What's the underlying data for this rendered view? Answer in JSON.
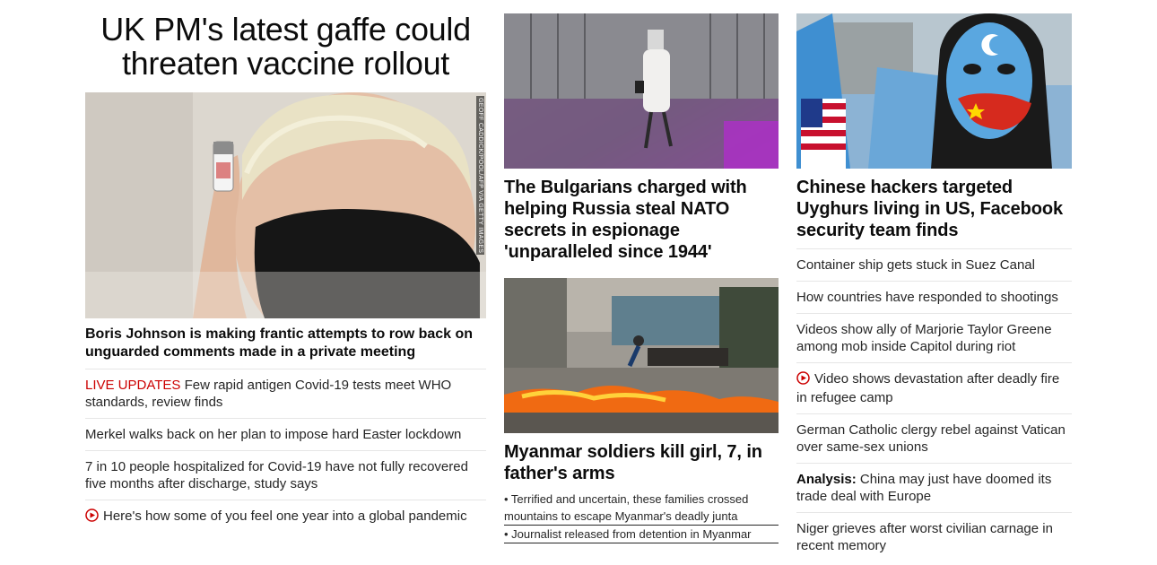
{
  "lead": {
    "title": "UK PM's latest gaffe could threaten vaccine rollout",
    "image_alt": "Boris Johnson holding vaccine vial, wearing black mask",
    "image_credit": "GEOFF CADDICK/POOL/AFP VIA GETTY IMAGES",
    "subheadline": "Boris Johnson is making frantic attempts to row back on unguarded comments made in a private meeting",
    "stories": [
      {
        "prefix": "LIVE UPDATES",
        "text": " Few rapid antigen Covid-19 tests meet WHO standards, review finds"
      },
      {
        "text": "Merkel walks back on her plan to impose hard Easter lockdown"
      },
      {
        "text": "7 in 10 people hospitalized for Covid-19 have not fully recovered five months after discharge, study says"
      },
      {
        "text": "Here's how some of you feel one year into a global pandemic",
        "icon": "play-icon"
      }
    ]
  },
  "middle": {
    "story1": {
      "title": "The Bulgarians charged with helping Russia steal NATO secrets in espionage 'unparalleled since 1944'"
    },
    "story2": {
      "title": "Myanmar soldiers kill girl, 7, in father's arms",
      "links": [
        "• Terrified and uncertain, these families crossed mountains to escape Myanmar's deadly junta",
        "• Journalist released from detention in Myanmar"
      ]
    }
  },
  "right": {
    "title": "Chinese hackers targeted Uyghurs living in US, Facebook security team finds",
    "stories": [
      {
        "text": "Container ship gets stuck in Suez Canal"
      },
      {
        "text": "How countries have responded to shootings"
      },
      {
        "text": "Videos show ally of Marjorie Taylor Greene among mob inside Capitol during riot"
      },
      {
        "text": "Video shows devastation after deadly fire in refugee camp",
        "icon": "play-icon"
      },
      {
        "text": "German Catholic clergy rebel against Vatican over same-sex unions"
      },
      {
        "prefix": "Analysis:",
        "text": " China may just have doomed its trade deal with Europe"
      },
      {
        "text": "Niger grieves after worst civilian carnage in recent memory"
      }
    ]
  },
  "colors": {
    "live": "#cc0000",
    "headline": "#0c0c0c",
    "body_text": "#262626",
    "divider": "#e6e6e6"
  }
}
